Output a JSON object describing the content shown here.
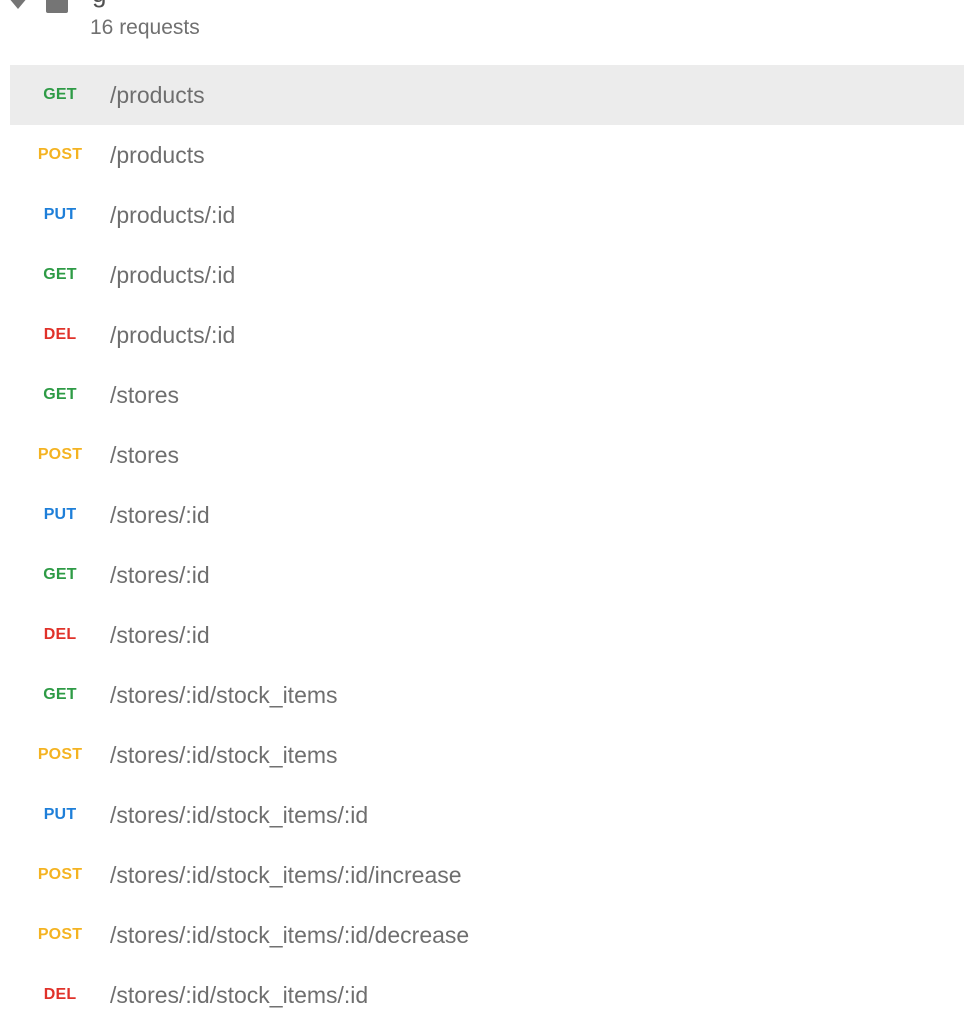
{
  "collection": {
    "name": "g",
    "request_count_label": "16 requests"
  },
  "icons": {
    "caret": "caret-down-icon",
    "folder": "folder-icon"
  },
  "method_colors": {
    "GET": "#2e9b46",
    "POST": "#f4b322",
    "PUT": "#1e7fd9",
    "DEL": "#e0322a"
  },
  "selected_index": 0,
  "requests": [
    {
      "method": "GET",
      "path": "/products"
    },
    {
      "method": "POST",
      "path": "/products"
    },
    {
      "method": "PUT",
      "path": "/products/:id"
    },
    {
      "method": "GET",
      "path": "/products/:id"
    },
    {
      "method": "DEL",
      "path": "/products/:id"
    },
    {
      "method": "GET",
      "path": "/stores"
    },
    {
      "method": "POST",
      "path": "/stores"
    },
    {
      "method": "PUT",
      "path": "/stores/:id"
    },
    {
      "method": "GET",
      "path": "/stores/:id"
    },
    {
      "method": "DEL",
      "path": "/stores/:id"
    },
    {
      "method": "GET",
      "path": "/stores/:id/stock_items"
    },
    {
      "method": "POST",
      "path": "/stores/:id/stock_items"
    },
    {
      "method": "PUT",
      "path": "/stores/:id/stock_items/:id"
    },
    {
      "method": "POST",
      "path": "/stores/:id/stock_items/:id/increase"
    },
    {
      "method": "POST",
      "path": "/stores/:id/stock_items/:id/decrease"
    },
    {
      "method": "DEL",
      "path": "/stores/:id/stock_items/:id"
    }
  ]
}
